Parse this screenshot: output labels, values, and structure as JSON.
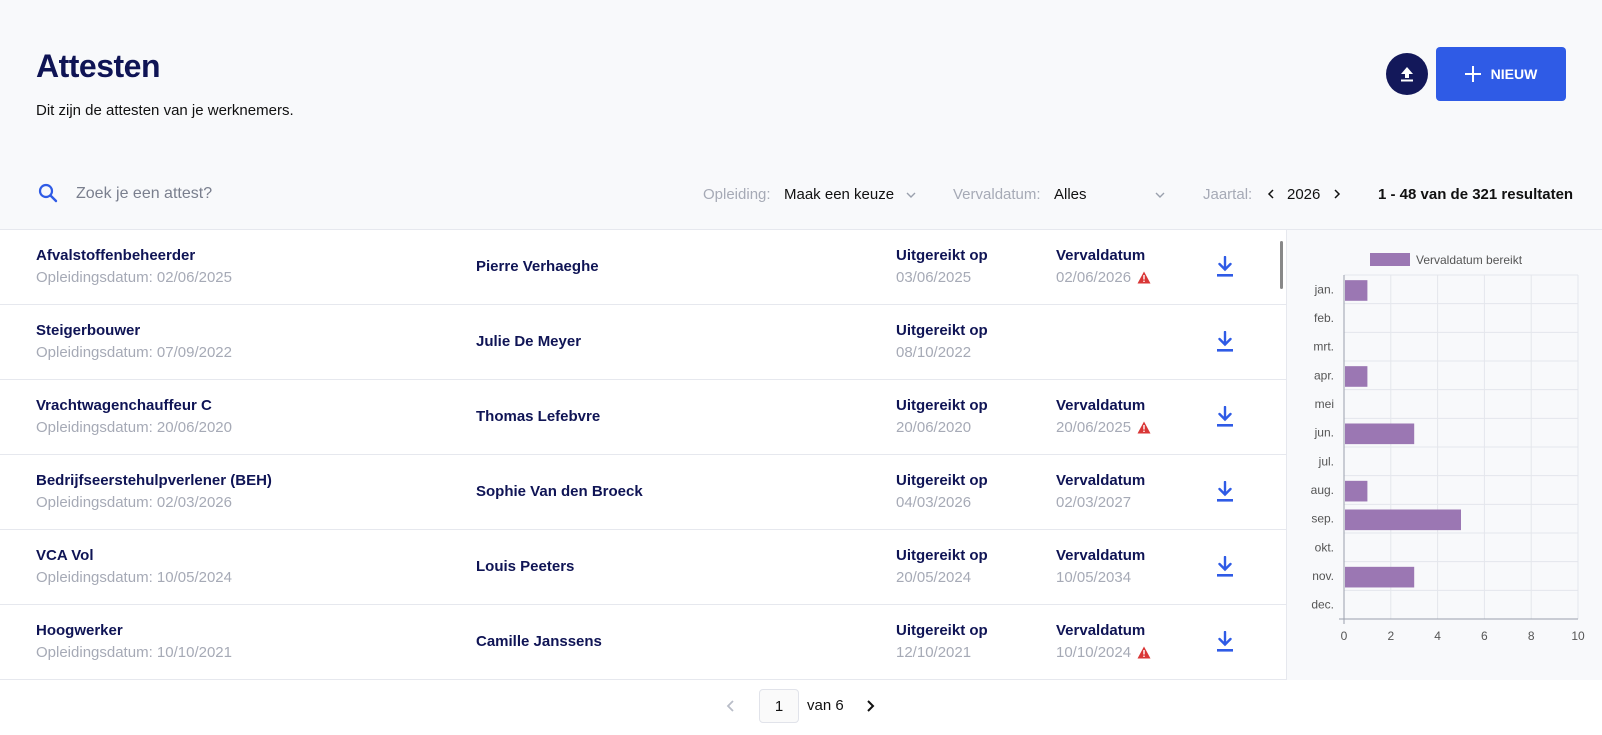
{
  "header": {
    "title": "Attesten",
    "subtitle": "Dit zijn de attesten van je werknemers.",
    "new_label": "NIEUW",
    "upload_icon": "upload-icon"
  },
  "filters": {
    "search_placeholder": "Zoek je een attest?",
    "opleiding_label": "Opleiding:",
    "opleiding_value": "Maak een keuze",
    "vervaldatum_label": "Vervaldatum:",
    "vervaldatum_value": "Alles",
    "jaartal_label": "Jaartal:",
    "jaartal_value": "2026",
    "results": "1 - 48 van de 321 resultaten"
  },
  "columns": {
    "issued_label": "Uitgereikt op",
    "expiry_label": "Vervaldatum"
  },
  "rows": [
    {
      "course": "Afvalstoffenbeheerder",
      "training_date": "Opleidingsdatum: 02/06/2025",
      "person": "Pierre Verhaeghe",
      "issued": "03/06/2025",
      "expiry": "02/06/2026",
      "warning": true
    },
    {
      "course": "Steigerbouwer",
      "training_date": "Opleidingsdatum: 07/09/2022",
      "person": "Julie De Meyer",
      "issued": "08/10/2022",
      "expiry": "",
      "warning": false
    },
    {
      "course": "Vrachtwagenchauffeur C",
      "training_date": "Opleidingsdatum: 20/06/2020",
      "person": "Thomas Lefebvre",
      "issued": "20/06/2020",
      "expiry": "20/06/2025",
      "warning": true
    },
    {
      "course": "Bedrijfseerstehulpverlener (BEH)",
      "training_date": "Opleidingsdatum: 02/03/2026",
      "person": "Sophie Van den Broeck",
      "issued": "04/03/2026",
      "expiry": "02/03/2027",
      "warning": false
    },
    {
      "course": "VCA Vol",
      "training_date": "Opleidingsdatum: 10/05/2024",
      "person": "Louis Peeters",
      "issued": "20/05/2024",
      "expiry": "10/05/2034",
      "warning": false
    },
    {
      "course": "Hoogwerker",
      "training_date": "Opleidingsdatum: 10/10/2021",
      "person": "Camille Janssens",
      "issued": "12/10/2021",
      "expiry": "10/10/2024",
      "warning": true
    }
  ],
  "pagination": {
    "current": "1",
    "of": "van 6"
  },
  "colors": {
    "accent": "#2f5be6",
    "navy": "#13185a",
    "bar": "#9b77b3",
    "warning": "#d93636"
  },
  "chart_data": {
    "type": "bar",
    "orientation": "horizontal",
    "categories": [
      "jan.",
      "feb.",
      "mrt.",
      "apr.",
      "mei",
      "jun.",
      "jul.",
      "aug.",
      "sep.",
      "okt.",
      "nov.",
      "dec."
    ],
    "series": [
      {
        "name": "Vervaldatum bereikt",
        "values": [
          1,
          0,
          0,
          1,
          0,
          3,
          0,
          1,
          5,
          0,
          3,
          0
        ]
      }
    ],
    "xlim": [
      0,
      10
    ],
    "xticks": [
      "0",
      "2",
      "4",
      "6",
      "8",
      "10"
    ],
    "grid": true,
    "legend": "top"
  }
}
